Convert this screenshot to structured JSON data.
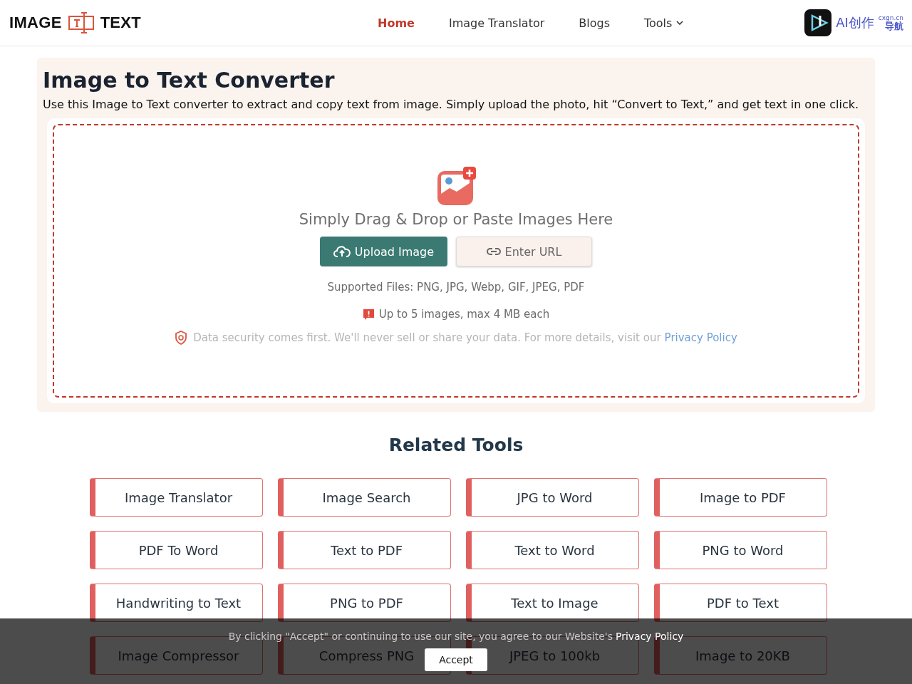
{
  "header": {
    "logo": {
      "left": "IMAGE",
      "right": "TEXT"
    },
    "nav": [
      {
        "label": "Home",
        "selected": true,
        "kind": "link"
      },
      {
        "label": "Image Translator",
        "selected": false,
        "kind": "link"
      },
      {
        "label": "Blogs",
        "selected": false,
        "kind": "link"
      },
      {
        "label": "Tools",
        "selected": false,
        "kind": "dropdown"
      }
    ],
    "partner": {
      "name": "AI创作",
      "domain": "cxgn.cn",
      "sub": "导航"
    }
  },
  "converter": {
    "title": "Image to Text Converter",
    "description": "Use this Image to Text converter to extract and copy text from image. Simply upload the photo, hit “Convert to Text,” and get text in one click.",
    "drop_hint": "Simply Drag & Drop or Paste Images Here",
    "upload_button": "Upload Image",
    "url_button": "Enter URL",
    "supported": "Supported Files: PNG, JPG, Webp, GIF, JPEG, PDF",
    "limit": "Up to 5 images, max 4 MB each",
    "security": "Data security comes first. We'll never sell or share your data. For more details, visit our",
    "security_link": "Privacy Policy"
  },
  "related": {
    "title": "Related Tools",
    "tools": [
      "Image Translator",
      "Image Search",
      "JPG to Word",
      "Image to PDF",
      "PDF To Word",
      "Text to PDF",
      "Text to Word",
      "PNG to Word",
      "Handwriting to Text",
      "PNG to PDF",
      "Text to Image",
      "PDF to Text",
      "Image Compressor",
      "Compress PNG",
      "JPEG to 100kb",
      "Image to 20KB"
    ]
  },
  "cookie_bar": {
    "text": "By clicking \"Accept\" or continuing to use our site, you agree to our Website's",
    "link": "Privacy Policy",
    "button": "Accept"
  }
}
